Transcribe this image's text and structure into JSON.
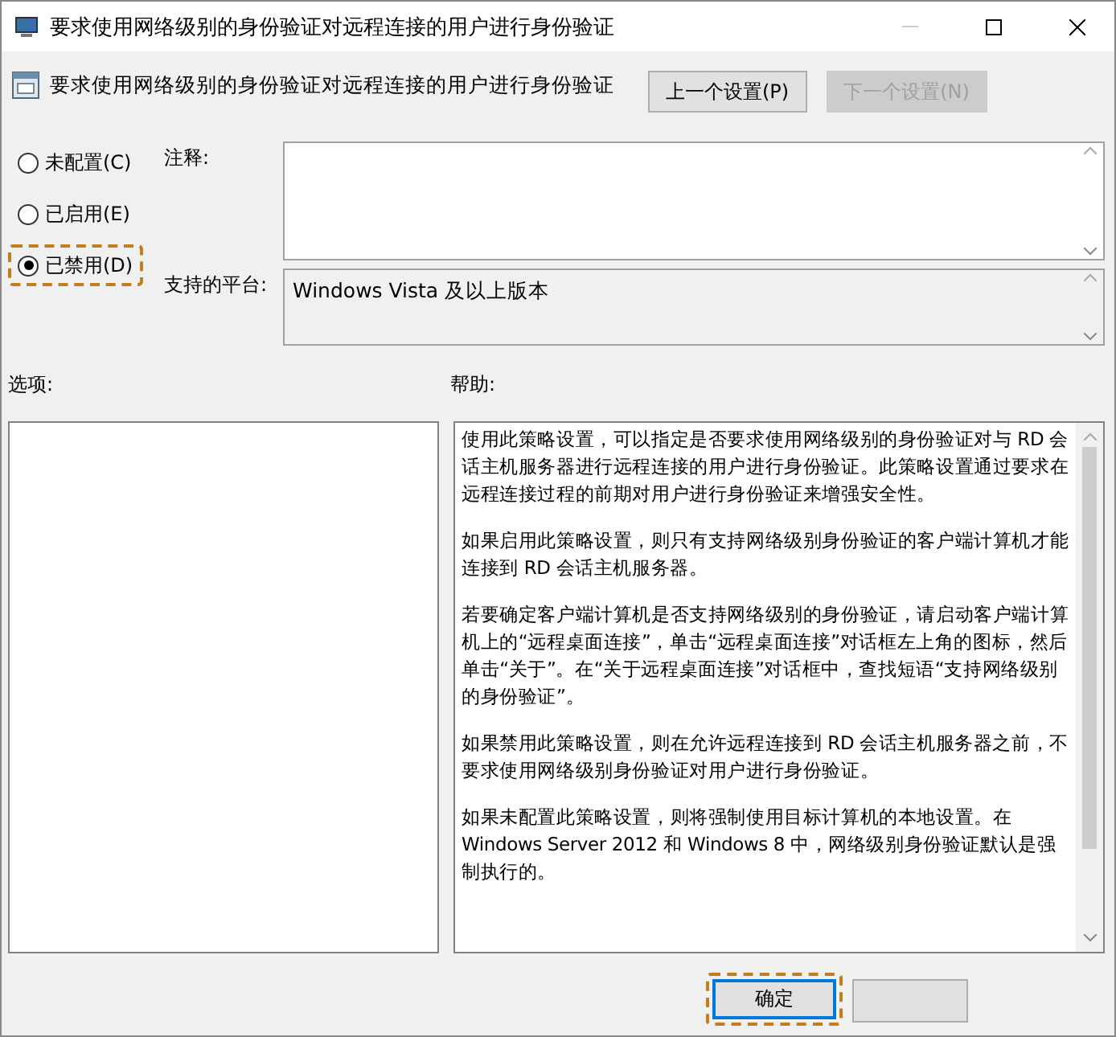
{
  "window": {
    "title": "要求使用网络级别的身份验证对远程连接的用户进行身份验证"
  },
  "header": {
    "setting_name": "要求使用网络级别的身份验证对远程连接的用户进行身份验证",
    "buttons": [
      {
        "label": "上一个设置(P)",
        "disabled": false
      },
      {
        "label": "下一个设置(N)",
        "disabled": true
      }
    ]
  },
  "options": [
    {
      "label": "未配置(C)",
      "selected": false,
      "highlighted": false
    },
    {
      "label": "已启用(E)",
      "selected": false,
      "highlighted": false
    },
    {
      "label": "已禁用(D)",
      "selected": true,
      "highlighted": true
    }
  ],
  "comment": {
    "label": "注释:"
  },
  "platform": {
    "label": "支持的平台:",
    "value": "Windows Vista 及以上版本"
  },
  "options_label": "选项:",
  "help": {
    "label": "帮助:",
    "paragraphs": [
      "使用此策略设置，可以指定是否要求使用网络级别的身份验证对与 RD 会话主机服务器进行远程连接的用户进行身份验证。此策略设置通过要求在远程连接过程的前期对用户进行身份验证来增强安全性。",
      "如果启用此策略设置，则只有支持网络级别身份验证的客户端计算机才能连接到 RD 会话主机服务器。",
      "若要确定客户端计算机是否支持网络级别的身份验证，请启动客户端计算机上的“远程桌面连接”，单击“远程桌面连接”对话框左上角的图标，然后单击“关于”。在“关于远程桌面连接”对话框中，查找短语“支持网络级别的身份验证”。",
      "如果禁用此策略设置，则在允许远程连接到 RD 会话主机服务器之前，不要求使用网络级别身份验证对用户进行身份验证。",
      "如果未配置此策略设置，则将强制使用目标计算机的本地设置。在 Windows Server 2012 和 Windows 8 中，网络级别身份验证默认是强制执行的。"
    ]
  },
  "footer": {
    "ok": {
      "label": "确定",
      "highlighted": true
    }
  }
}
